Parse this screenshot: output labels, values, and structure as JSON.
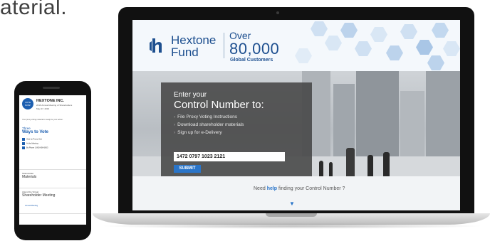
{
  "lead_text": "aterial.",
  "laptop": {
    "site": {
      "logo_name_line1": "Hextone",
      "logo_name_line2": "Fund",
      "over_label": "Over",
      "over_count": "80,000",
      "over_sub": "Global Customers",
      "panel": {
        "title_line1": "Enter your",
        "title_line2": "Control Number to:",
        "items": [
          "File Proxy Voting Instructions",
          "Download shareholder materials",
          "Sign up for e-Delivery"
        ],
        "input_value": "1472 0797 1023 2121",
        "submit_label": "SUBMIT"
      },
      "help": {
        "prefix": "Need ",
        "link": "help",
        "suffix": " finding your Control Number ?"
      }
    },
    "colors": {
      "brand_blue": "#1d4f8f",
      "accent_blue": "#2a75c9"
    }
  },
  "phone": {
    "logo_text": "VOTE NOW!",
    "title": "HEXTONE INC.",
    "subtitle": "2016 Annual Meeting of Shareholders",
    "date": "May 27, 2016",
    "notice": "Your proxy voting material is ready for your action.",
    "three": "Three",
    "ways": "Ways to Vote",
    "options": [
      "Vote by Proxy Vote",
      "At the Meeting",
      "By Phone 1-800-690-6903"
    ],
    "materials_label": "Shareholder",
    "materials_title": "Materials",
    "meeting_label": "Attend the Virtual",
    "meeting_title": "Shareholder Meeting",
    "meeting_link": "Annual Meeting"
  }
}
